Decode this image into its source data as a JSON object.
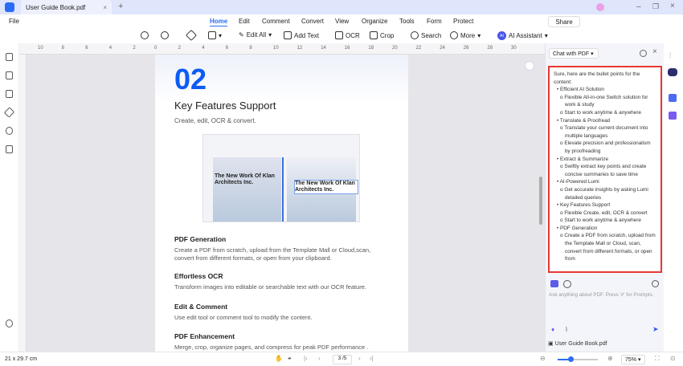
{
  "window": {
    "tab_title": "User Guide Book.pdf",
    "new_tab": "+",
    "close_tab": "×"
  },
  "menu": {
    "file": "File",
    "tabs": [
      "Home",
      "Edit",
      "Comment",
      "Convert",
      "View",
      "Organize",
      "Tools",
      "Form",
      "Protect"
    ],
    "active": "Home",
    "share": "Share"
  },
  "toolbar": {
    "edit_all": "Edit All",
    "add_text": "Add Text",
    "ocr": "OCR",
    "crop": "Crop",
    "search": "Search",
    "more": "More",
    "ai_assistant": "AI Assistant",
    "ai_badge": "AI"
  },
  "ruler": {
    "left": [
      "10",
      "8",
      "6",
      "4",
      "2"
    ],
    "top": [
      "0",
      "2",
      "4",
      "6",
      "8",
      "10",
      "12",
      "14",
      "16",
      "18",
      "20",
      "22",
      "24",
      "26",
      "28",
      "30"
    ]
  },
  "page": {
    "number": "02",
    "title": "Key Features Support",
    "subtitle": "Create, edit, OCR & convert.",
    "screenshot_text": "The New Work Of Klan Architects Inc.",
    "sections": [
      {
        "heading": "PDF Generation",
        "body": "Create a PDF from scratch, upload from the Template Mall or Cloud,scan, convert from different formats, or open from your clipboard."
      },
      {
        "heading": "Effortless OCR",
        "body": "Transform images into editable or searchable text with our OCR feature."
      },
      {
        "heading": "Edit & Comment",
        "body": "Use edit tool or comment tool to modify the content."
      },
      {
        "heading": "PDF Enhancement",
        "body": "Merge, crop, organize pages, and compress for peak PDF performance ."
      }
    ]
  },
  "chat": {
    "mode": "Chat with PDF",
    "intro": "Sure, here are the bullet points for the content:",
    "items": [
      {
        "t": "Efficient AI Solution",
        "s": [
          "Flexible All-in-one Switch solution for work & study",
          "Start to work anytime & anywhere"
        ]
      },
      {
        "t": "Translate & Proofread",
        "s": [
          "Translate your current document into multiple languages",
          "Elevate precision and professionalism by proofreading"
        ]
      },
      {
        "t": "Extract & Summarize",
        "s": [
          "Swiftly extract key points and create concise summaries to save time"
        ]
      },
      {
        "t": "AI-Powered Lumi",
        "s": [
          "Get accurate insights by asking Lumi detailed queries"
        ]
      },
      {
        "t": "Key Features Support",
        "s": [
          "Flexible Create, edit, OCR & convert",
          "Start to work anytime & anywhere"
        ]
      },
      {
        "t": "PDF Generation",
        "s": [
          "Create a PDF from scratch, upload from the Template Mall or Cloud, scan, convert from different formats, or open from"
        ]
      }
    ],
    "input_placeholder": "Ask anything about PDF. Press '#' for Prompts.",
    "file": "User Guide Book.pdf"
  },
  "status": {
    "page_size": "21 x 29.7 cm",
    "page_indicator": "3 /5",
    "zoom": "75%",
    "zoom_fraction": 0.3
  },
  "colors": {
    "accent": "#2a6df5",
    "highlight_border": "#e53935"
  }
}
